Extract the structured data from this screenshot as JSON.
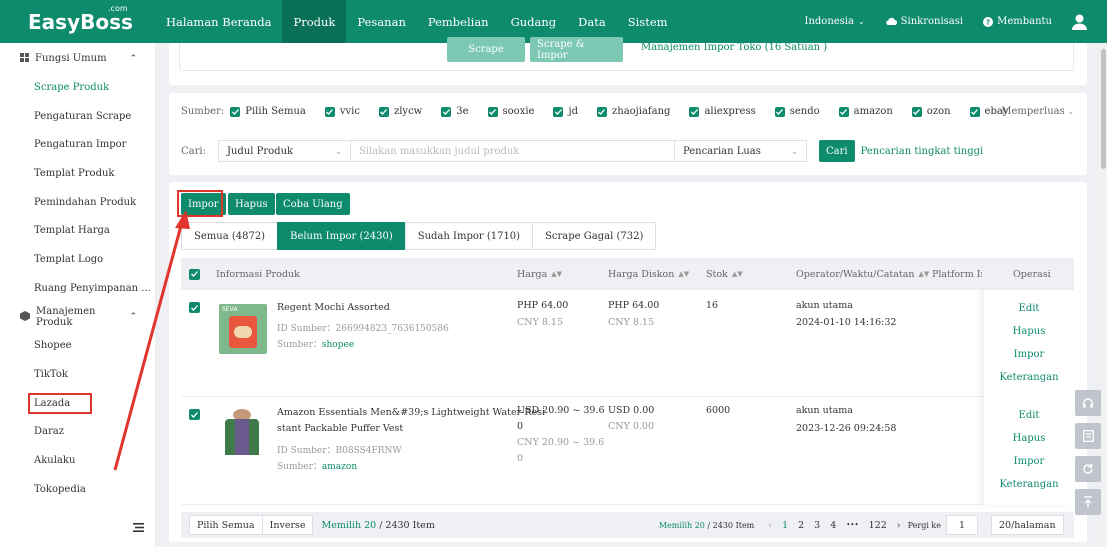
{
  "app": {
    "logo": "EasyBoss",
    "logo_sup": ".com"
  },
  "nav": [
    "Halaman Beranda",
    "Produk",
    "Pesanan",
    "Pembelian",
    "Gudang",
    "Data",
    "Sistem"
  ],
  "top_right": {
    "region": "Indonesia",
    "sync": "Sinkronisasi",
    "help": "Membantu"
  },
  "sidebar": {
    "group1": "Fungsi Umum",
    "group1_items": [
      "Scrape Produk",
      "Pengaturan Scrape",
      "Pengaturan Impor",
      "Templat Produk",
      "Pemindahan Produk",
      "Templat Harga",
      "Templat Logo",
      "Ruang Penyimpanan ..."
    ],
    "group2": "Manajemen Produk",
    "group2_items": [
      "Shopee",
      "TikTok",
      "Lazada",
      "Daraz",
      "Akulaku",
      "Tokopedia"
    ]
  },
  "top_card": {
    "scrape": "Scrape",
    "scrape_import": "Scrape & Impor",
    "manage_link": "Manajemen Impor Toko (16 Satuan )"
  },
  "filter": {
    "source_label": "Sumber:",
    "sources": [
      "Pilih Semua",
      "vvic",
      "zlycw",
      "3e",
      "sooxie",
      "jd",
      "zhaojiafang",
      "aliexpress",
      "sendo",
      "amazon",
      "ozon",
      "ebay"
    ],
    "expand": "Memperluas",
    "search_label": "Cari:",
    "field_select": "Judul Produk",
    "search_placeholder": "Silakan masukkan judul produk",
    "mode_select": "Pencarian Luas",
    "search_btn": "Cari",
    "advanced": "Pencarian tingkat tinggi"
  },
  "actions": {
    "import": "Impor",
    "delete": "Hapus",
    "retry": "Coba Ulang"
  },
  "tabs": [
    "Semua (4872)",
    "Belum Impor (2430)",
    "Sudah Impor (1710)",
    "Scrape Gagal (732)"
  ],
  "columns": {
    "info": "Informasi Produk",
    "price": "Harga",
    "discount": "Harga Diskon",
    "stock": "Stok",
    "operator": "Operator/Waktu/Catatan",
    "platform": "Platform Imp",
    "ops": "Operasi"
  },
  "rows": [
    {
      "thumb_tag": "SEVA",
      "title": "Regent Mochi Assorted",
      "source_id": "ID Sumber：266994823_7636150586",
      "source_label": "Sumber：",
      "source": "shopee",
      "price1": "PHP 64.00",
      "price2": "CNY 8.15",
      "disc1": "PHP 64.00",
      "disc2": "CNY 8.15",
      "stock": "16",
      "operator": "akun utama",
      "time": "2024-01-10 14:16:32"
    },
    {
      "title1": "Amazon Essentials Men&#39;s Lightweight Water-Resi",
      "title2": "stant Packable Puffer Vest",
      "source_id": "ID Sumber：B08SS4FRNW",
      "source_label": "Sumber：",
      "source": "amazon",
      "price1a": "USD 20.90 ~ 39.6",
      "price1b": "0",
      "price2a": "CNY 20.90 ~ 39.6",
      "price2b": "0",
      "disc1": "USD 0.00",
      "disc2": "CNY 0.00",
      "stock": "6000",
      "operator": "akun utama",
      "time": "2023-12-26 09:24:58"
    }
  ],
  "ops": [
    "Edit",
    "Hapus",
    "Impor",
    "Keterangan"
  ],
  "footer": {
    "select_all": "Pilih Semua",
    "inverse": "Inverse",
    "selected_prefix": "Memilih 20",
    "selected_suffix": " / 2430 Item",
    "selected_small_a": "Memilih 20",
    "selected_small_b": "/ 2430 Item",
    "pages": [
      "1",
      "2",
      "3",
      "4",
      "•••",
      "122"
    ],
    "goto_label": "Pergi ke",
    "goto_value": "1",
    "page_size": "20/halaman"
  },
  "colors": {
    "primary": "#0e8a6c",
    "highlight": "#e0342c"
  }
}
